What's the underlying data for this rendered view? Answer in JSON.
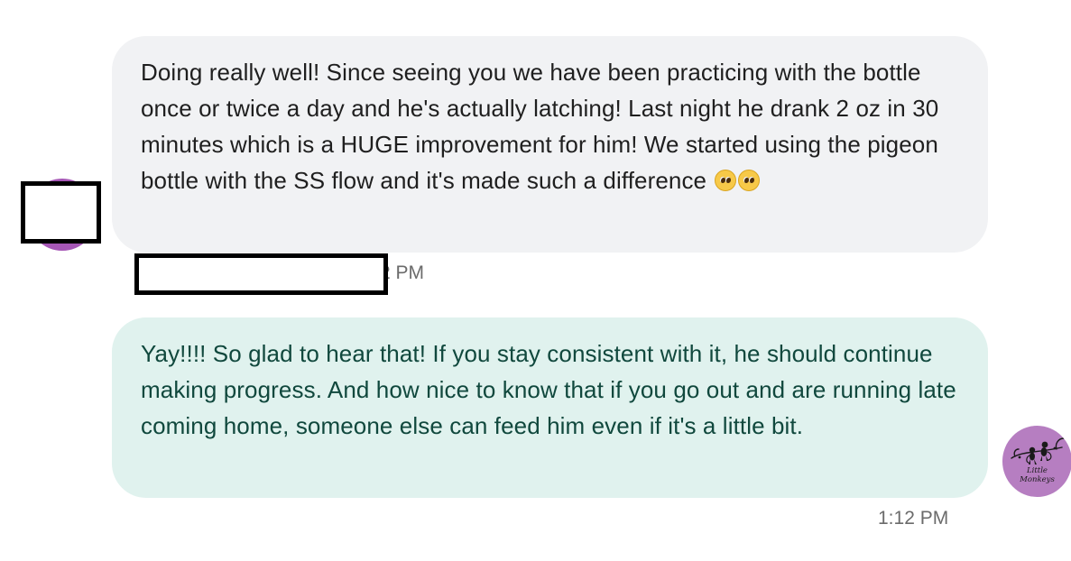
{
  "conversation": {
    "incoming": {
      "message_text": "Doing really well! Since seeing you we have been practicing with the bottle once or twice a day and he's actually latching! Last night he drank 2 oz in 30 minutes which is a HUGE improvement for him! We started using the pigeon bottle with the SS flow and it's made such a difference",
      "emoji_icon": "pleading-face-icon",
      "emoji_count": 2,
      "time_visible": "2 PM",
      "avatar_color": "#a657b6"
    },
    "outgoing": {
      "message_text": "Yay!!!! So glad to hear that! If you stay consistent with it, he should continue making progress. And how nice to know that if you go out and are running late coming home, someone else can feed him even if it's a little bit.",
      "time": "1:12 PM",
      "avatar_icon": "little-monkeys-logo-icon",
      "avatar_color": "#b67ec1",
      "avatar_logo_text": "Little Monkeys"
    }
  },
  "colors": {
    "incoming_bubble": "#f1f2f4",
    "outgoing_bubble": "#e0f2ee",
    "outgoing_text": "#10483d",
    "timestamp_text": "#6b6b6b"
  }
}
